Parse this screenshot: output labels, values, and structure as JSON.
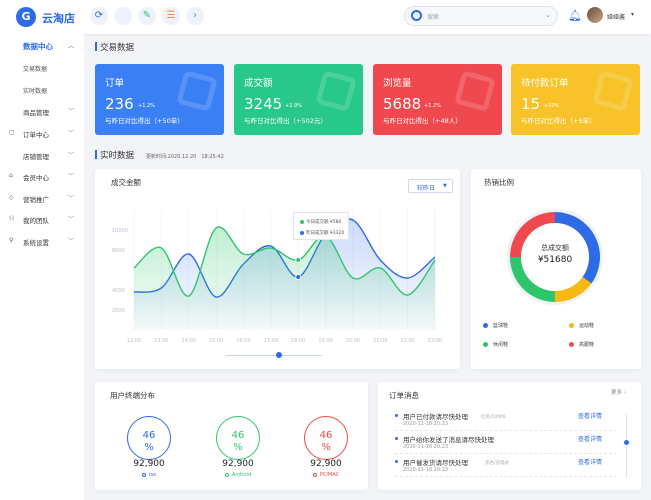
{
  "app": {
    "name": "云淘店",
    "logo_letter": "G"
  },
  "topbar": {
    "search_placeholder": "搜索",
    "username": "娅娅酱"
  },
  "sidebar": {
    "items": [
      {
        "label": "数据中心",
        "icon": "data-icon",
        "active": true,
        "chevron": "up"
      },
      {
        "label": "交易数据",
        "sub": true
      },
      {
        "label": "实时数据",
        "sub": true
      },
      {
        "label": "商品管理",
        "chevron": "down"
      },
      {
        "label": "订单中心",
        "icon": "order-icon",
        "chevron": "down"
      },
      {
        "label": "店铺管理",
        "chevron": "down"
      },
      {
        "label": "会员中心",
        "icon": "member-icon",
        "chevron": "down"
      },
      {
        "label": "营销推广",
        "icon": "marketing-icon",
        "chevron": "down"
      },
      {
        "label": "我的团队",
        "icon": "team-icon",
        "chevron": "down"
      },
      {
        "label": "系统设置",
        "icon": "settings-icon",
        "chevron": "down"
      }
    ]
  },
  "trade": {
    "title": "交易数据",
    "cards": [
      {
        "title": "订单",
        "value": "236",
        "percent": "+1.2%",
        "compare": "与昨日对比得出（+50单）",
        "color": "#3b7ff5"
      },
      {
        "title": "成交额",
        "value": "3245",
        "percent": "+1.9%",
        "compare": "与昨日对比得出（+502元）",
        "color": "#27c88a"
      },
      {
        "title": "浏览量",
        "value": "5688",
        "percent": "+1.2%",
        "compare": "与昨日对比得出（+48人）",
        "color": "#f0484f"
      },
      {
        "title": "待付款订单",
        "value": "15",
        "percent": "+10%",
        "compare": "与昨日对比得出（+5单）",
        "color": "#f7c329"
      }
    ]
  },
  "realtime": {
    "title": "实时数据",
    "updated": "更新时间:2020.12.20　18:25:42"
  },
  "amount_chart": {
    "title": "成交金额",
    "period": "较昨日",
    "tooltip": {
      "today": "今日成交额 ¥580",
      "yesterday": "昨日成交额 ¥3320"
    }
  },
  "hot_sales": {
    "title": "热销比例",
    "center_label": "总成交额",
    "center_value": "¥51680",
    "legend": [
      {
        "name": "篮球鞋",
        "color": "#2e6be6"
      },
      {
        "name": "运动鞋",
        "color": "#f5b90f"
      },
      {
        "name": "休闲鞋",
        "color": "#2fc56d"
      },
      {
        "name": "高跟鞋",
        "color": "#f0484f"
      }
    ]
  },
  "terminals": {
    "title": "用户终端分布",
    "items": [
      {
        "percent": "46",
        "pct_sign": "%",
        "count": "92,900",
        "label": "ios",
        "color": "#2e6be6"
      },
      {
        "percent": "46",
        "pct_sign": "%",
        "count": "92,900",
        "label": "Android",
        "color": "#2fc56d"
      },
      {
        "percent": "46",
        "pct_sign": "%",
        "count": "92,900",
        "label": "PC/MAC",
        "color": "#f0484f"
      }
    ]
  },
  "orders": {
    "title": "订单消息",
    "more": "更多 ›",
    "items": [
      {
        "text": "用户已付款请尽快处理",
        "time": "2020-11-18 20:23",
        "tag": "红色/100ML",
        "link": "查看详情"
      },
      {
        "text": "用户给你发送了消息请尽快处理",
        "time": "2020-11-18 20:23",
        "tag": "",
        "link": "查看详情"
      },
      {
        "text": "用户催发货请尽快处理",
        "time": "2020-11-18 20:23",
        "tag": "黑色/充电式",
        "link": "查看详情"
      }
    ]
  },
  "chart_data": [
    {
      "type": "area",
      "title": "成交金额",
      "x": [
        "12:00",
        "13:00",
        "14:00",
        "15:00",
        "16:00",
        "17:00",
        "18:00",
        "19:00",
        "20:00",
        "21:00",
        "22:00",
        "23:00"
      ],
      "ylim": [
        0,
        12000
      ],
      "yticks": [
        2000,
        4000,
        8000,
        10000
      ],
      "series": [
        {
          "name": "今日成交额",
          "color": "#2fc56d",
          "values": [
            6200,
            8200,
            3400,
            10200,
            7600,
            8200,
            7000,
            9400,
            5200,
            6200,
            3500,
            7000
          ]
        },
        {
          "name": "昨日成交额",
          "color": "#2e6be6",
          "values": [
            3800,
            4200,
            7600,
            3300,
            6600,
            8400,
            5300,
            9600,
            11000,
            7000,
            5200,
            7300
          ]
        }
      ]
    },
    {
      "type": "pie",
      "title": "热销比例",
      "categories": [
        "篮球鞋",
        "运动鞋",
        "休闲鞋",
        "高跟鞋"
      ],
      "values": [
        35,
        15,
        25,
        25
      ],
      "colors": [
        "#2e6be6",
        "#f5b90f",
        "#2fc56d",
        "#f0484f"
      ]
    }
  ]
}
